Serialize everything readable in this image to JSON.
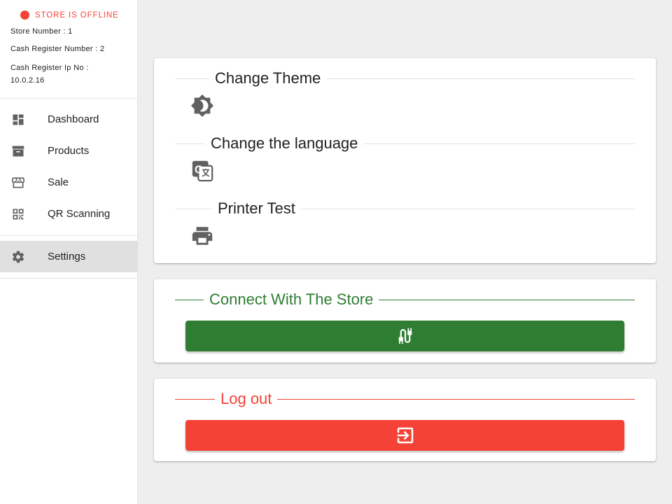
{
  "sidebar": {
    "status": "STORE IS OFFLINE",
    "store_number": "Store Number : 1",
    "register_number": "Cash Register Number : 2",
    "register_ip_label": "Cash Register Ip No :",
    "register_ip_value": "10.0.2.16",
    "items": [
      {
        "label": "Dashboard",
        "icon": "dashboard-icon"
      },
      {
        "label": "Products",
        "icon": "archive-box-icon"
      },
      {
        "label": "Sale",
        "icon": "storefront-icon"
      },
      {
        "label": "QR Scanning",
        "icon": "qr-code-icon"
      }
    ],
    "settings": {
      "label": "Settings",
      "icon": "gear-icon"
    }
  },
  "settings_card": {
    "theme_label": "Change Theme",
    "language_label": "Change the language",
    "printer_label": "Printer Test"
  },
  "connect_card": {
    "label": "Connect With The Store",
    "button_icon": "plug-cable-icon"
  },
  "logout_card": {
    "label": "Log out",
    "button_icon": "exit-to-app-icon"
  },
  "colors": {
    "offline": "#f44336",
    "connect": "#2e7d32",
    "logout": "#f44336",
    "icon_gray": "#616161"
  }
}
